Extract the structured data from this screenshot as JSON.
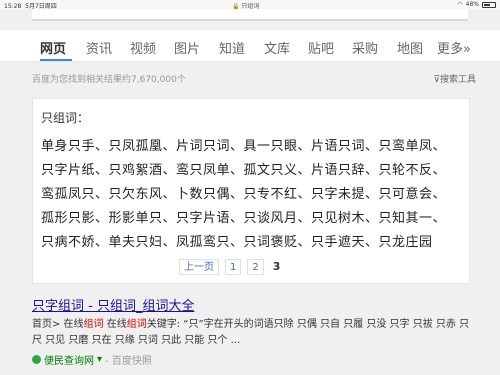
{
  "status_bar": {
    "time": "15:28",
    "date": "5月7日周四",
    "url": "只组词",
    "battery": "48%"
  },
  "nav": {
    "tabs": [
      "网页",
      "资讯",
      "视频",
      "图片",
      "知道",
      "文库",
      "贴吧",
      "采购",
      "地图",
      "更多»"
    ],
    "active_index": 0
  },
  "results_bar": {
    "count_text": "百度为您找到相关结果约7,670,000个",
    "tools_label": "搜索工具"
  },
  "panel": {
    "title": "只组词：",
    "rows": [
      "单身只手、只凤孤凰、片词只词、具一只眼、片语只词、只鸾单凤、",
      "只字片纸、只鸡絮酒、鸾只凤单、孤文只义、片语只辞、只轮不反、",
      "鸾孤凤只、只欠东风、卜数只偶、只专不红、只字未提、只可意会、",
      "孤形只影、形影单只、只字片语、只谈风月、只见树木、只知其一、",
      "只病不娇、单夫只妇、凤孤鸾只、只词褒贬、只手遮天、只龙庄园"
    ],
    "pager": {
      "prev": "上一页",
      "pages": [
        "1",
        "2"
      ],
      "current": "3"
    }
  },
  "result": {
    "title": "只字组词 - 只组词_组词大全",
    "snippet_prefix": "首页> 在线",
    "snippet_hl1": "组词",
    "snippet_mid": " 在线",
    "snippet_hl2": "组词",
    "snippet_rest": "关键字: “只”字在开头的词语只除 只偶 只自 只履 只没 只字 只祓 只赤 只尺 只见 只磨 只在 只缘 只词 只此 只能 只个 ...",
    "source": "便民查询网",
    "cache": "- 百度快照"
  }
}
